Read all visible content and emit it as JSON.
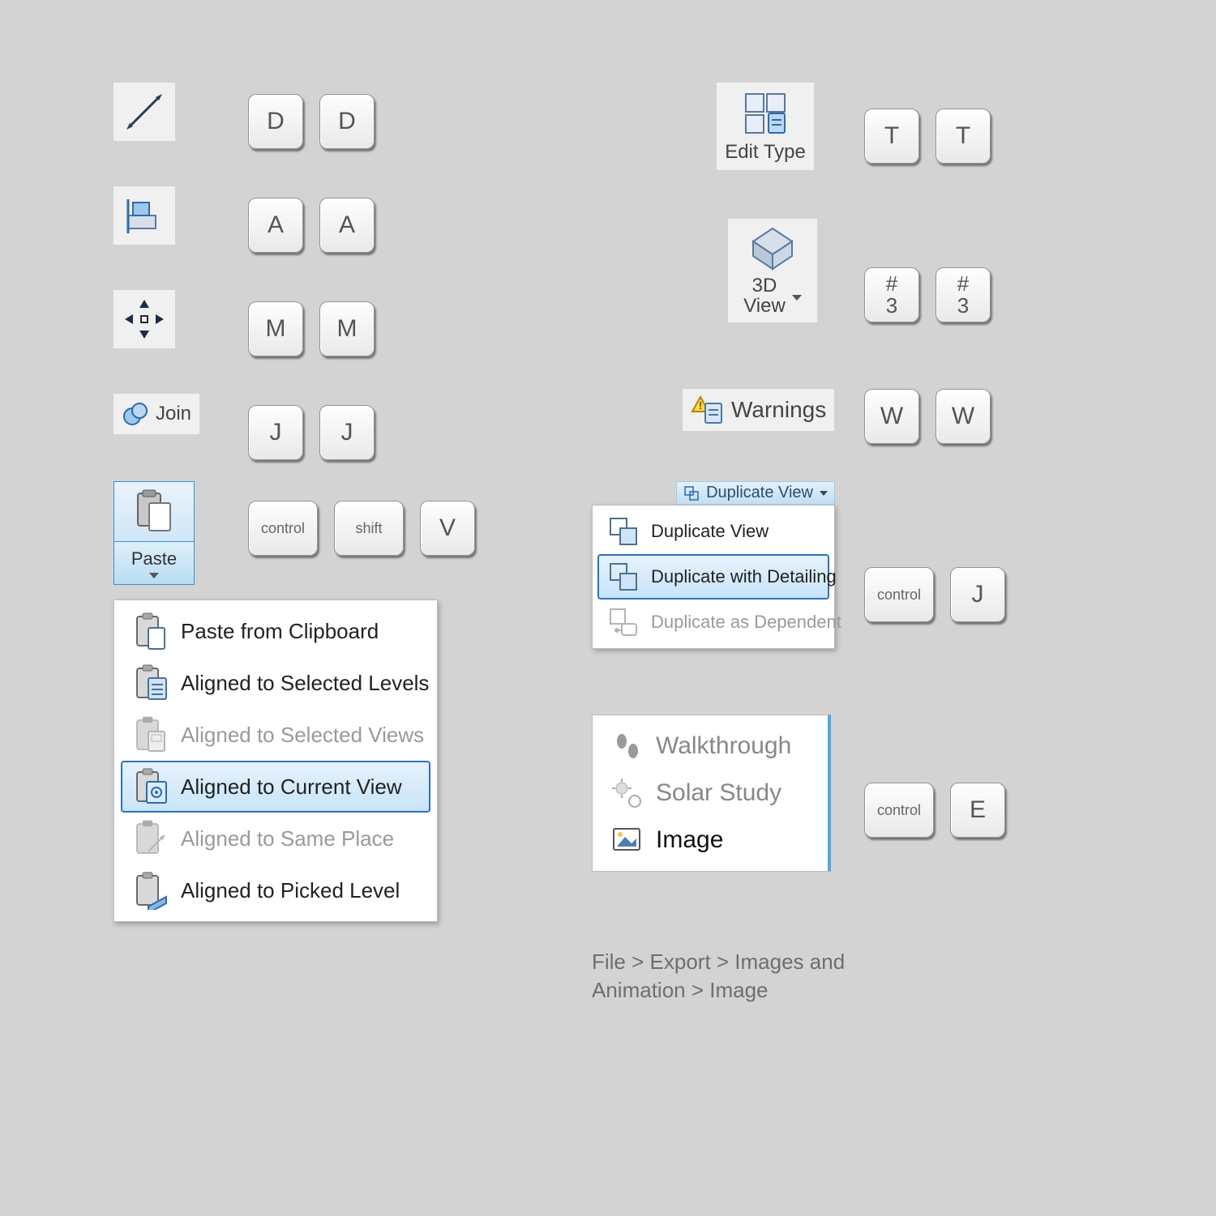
{
  "left": {
    "items": [
      {
        "icon": "dimension",
        "keys": [
          "D",
          "D"
        ]
      },
      {
        "icon": "align",
        "keys": [
          "A",
          "A"
        ]
      },
      {
        "icon": "move",
        "keys": [
          "M",
          "M"
        ]
      },
      {
        "icon": "join",
        "label": "Join",
        "keys": [
          "J",
          "J"
        ]
      }
    ],
    "paste": {
      "label": "Paste",
      "keys": [
        "control",
        "shift",
        "V"
      ],
      "menu": [
        {
          "label": "Paste from Clipboard",
          "icon": "clipboard",
          "disabled": false,
          "selected": false
        },
        {
          "label": "Aligned to Selected Levels",
          "icon": "clipboard-levels",
          "disabled": false,
          "selected": false
        },
        {
          "label": "Aligned to Selected Views",
          "icon": "clipboard-views",
          "disabled": true,
          "selected": false
        },
        {
          "label": "Aligned to Current View",
          "icon": "clipboard-current",
          "disabled": false,
          "selected": true
        },
        {
          "label": "Aligned to Same Place",
          "icon": "clipboard-same",
          "disabled": true,
          "selected": false
        },
        {
          "label": "Aligned to Picked Level",
          "icon": "clipboard-picked",
          "disabled": false,
          "selected": false
        }
      ]
    }
  },
  "right": {
    "edit_type": {
      "label": "Edit Type",
      "keys": [
        "T",
        "T"
      ]
    },
    "view3d": {
      "label_line1": "3D",
      "label_line2": "View",
      "keys_stack_top": "#",
      "keys_stack_bottom": "3"
    },
    "warnings": {
      "label": "Warnings",
      "keys": [
        "W",
        "W"
      ]
    },
    "duplicate": {
      "header": "Duplicate  View",
      "menu": [
        {
          "label": "Duplicate View",
          "disabled": false,
          "selected": false
        },
        {
          "label": "Duplicate with Detailing",
          "disabled": false,
          "selected": true
        },
        {
          "label": "Duplicate as Dependent",
          "disabled": true,
          "selected": false
        }
      ],
      "keys": [
        "control",
        "J"
      ]
    },
    "export_list": {
      "items": [
        {
          "label": "Walkthrough",
          "muted": true,
          "icon": "footsteps"
        },
        {
          "label": "Solar Study",
          "muted": true,
          "icon": "sun-gear"
        },
        {
          "label": "Image",
          "muted": false,
          "icon": "picture"
        }
      ],
      "keys": [
        "control",
        "E"
      ],
      "breadcrumb": "File > Export > Images and Animation > Image"
    }
  }
}
